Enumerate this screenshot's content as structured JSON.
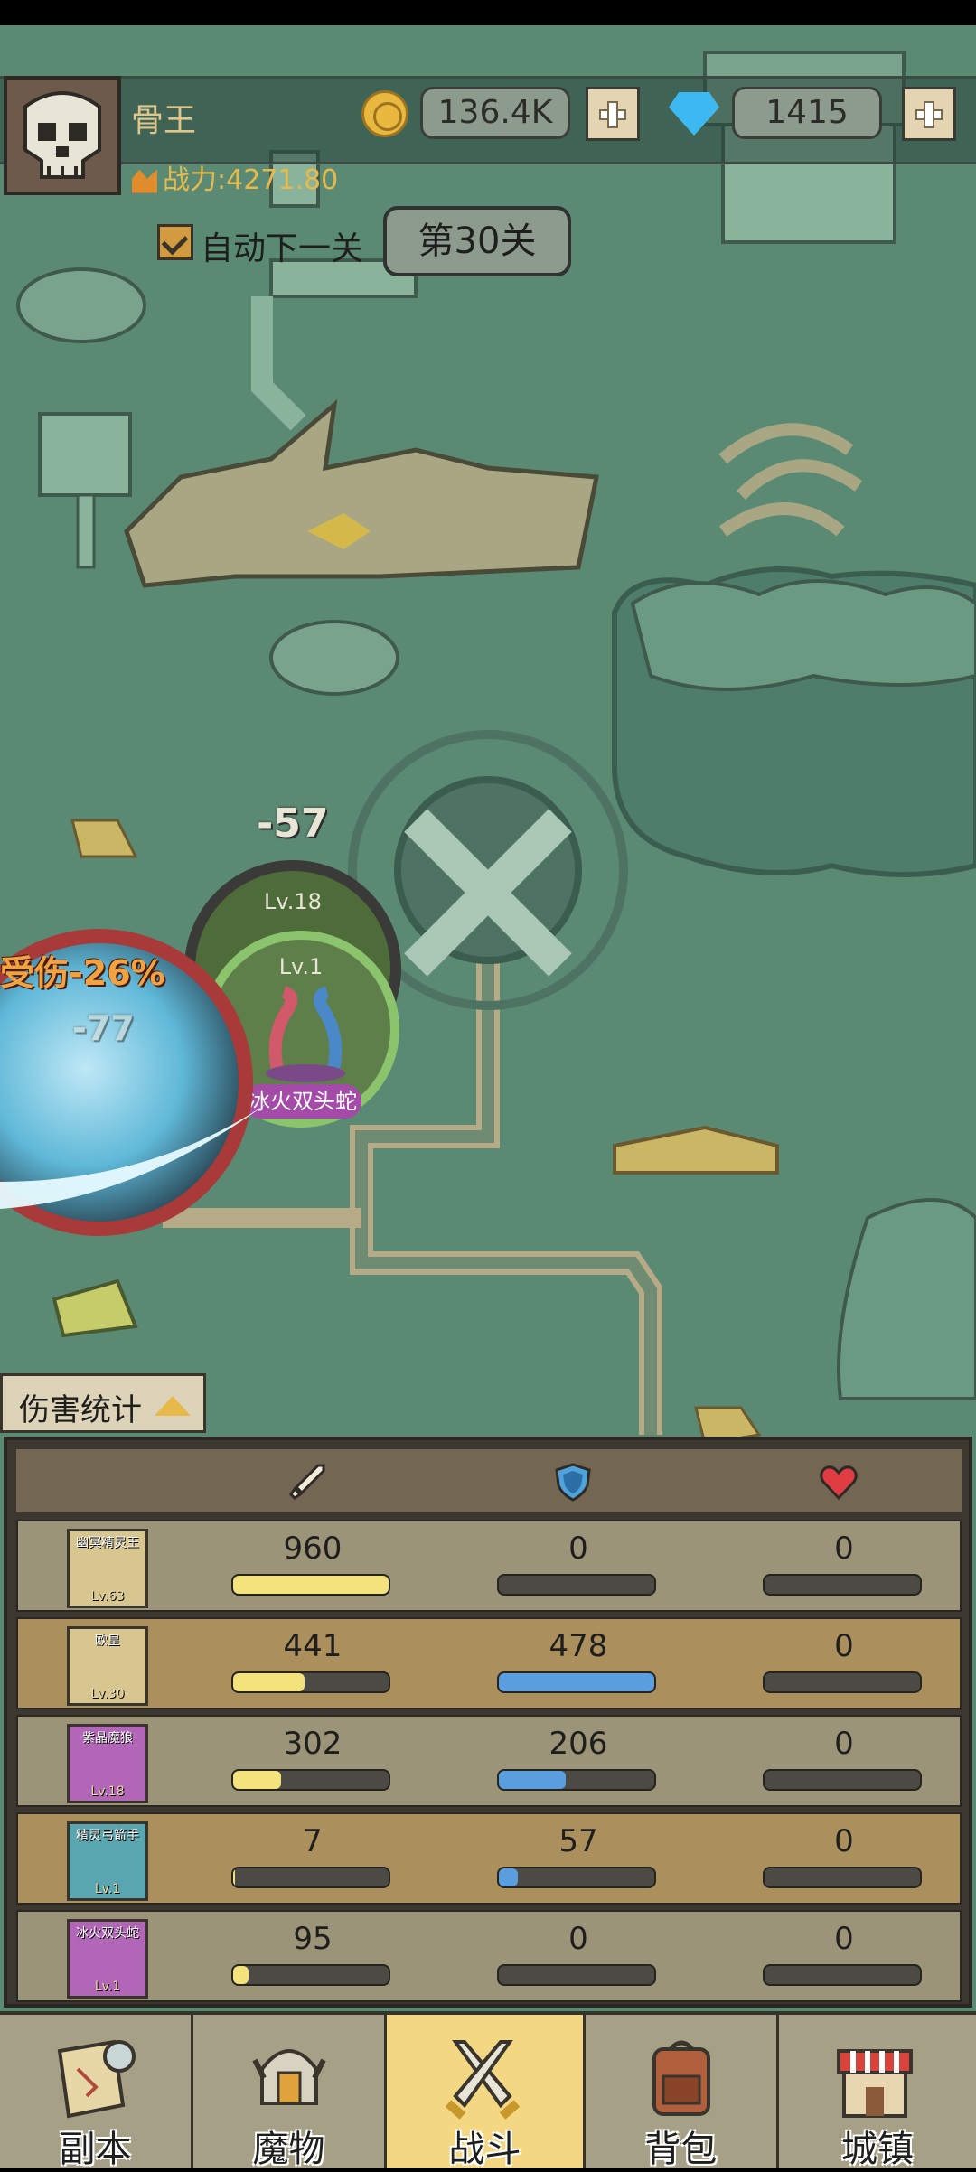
{
  "player": {
    "name": "骨王",
    "power": "战力:4271.80"
  },
  "currency": {
    "coins": "136.4K",
    "gems": "1415"
  },
  "stage": {
    "auto_next_label": "自动下一关",
    "auto_next_checked": true,
    "level_label": "第30关"
  },
  "battle": {
    "damage_floats": [
      "-57",
      "-77"
    ],
    "enemy_status": "受伤-26%",
    "units": [
      {
        "level": "Lv.18"
      },
      {
        "level": "Lv.1",
        "name": "冰火双头蛇"
      }
    ]
  },
  "damage_stats": {
    "toggle_label": "伤害统计",
    "columns": [
      {
        "icon": "sword-icon"
      },
      {
        "icon": "shield-icon"
      },
      {
        "icon": "heart-icon"
      }
    ],
    "rows": [
      {
        "name": "幽冥精灵王",
        "level": "Lv.63",
        "portrait_color": "#d8c690",
        "atk": "960",
        "def": "0",
        "heal": "0",
        "atk_frac": 1.0,
        "def_frac": 0,
        "heal_frac": 0
      },
      {
        "name": "欧皇",
        "level": "Lv.30",
        "portrait_color": "#d8c690",
        "atk": "441",
        "def": "478",
        "heal": "0",
        "atk_frac": 0.46,
        "def_frac": 1.0,
        "heal_frac": 0
      },
      {
        "name": "紫晶魔狼",
        "level": "Lv.18",
        "portrait_color": "#b266b8",
        "atk": "302",
        "def": "206",
        "heal": "0",
        "atk_frac": 0.31,
        "def_frac": 0.43,
        "heal_frac": 0
      },
      {
        "name": "精灵弓箭手",
        "level": "Lv.1",
        "portrait_color": "#5aa6b0",
        "atk": "7",
        "def": "57",
        "heal": "0",
        "atk_frac": 0.01,
        "def_frac": 0.12,
        "heal_frac": 0
      },
      {
        "name": "冰火双头蛇",
        "level": "Lv.1",
        "portrait_color": "#b266b8",
        "atk": "95",
        "def": "0",
        "heal": "0",
        "atk_frac": 0.1,
        "def_frac": 0,
        "heal_frac": 0
      }
    ]
  },
  "nav": {
    "active": 2,
    "items": [
      {
        "label": "副本",
        "icon": "map-scroll-icon"
      },
      {
        "label": "魔物",
        "icon": "helmet-icon"
      },
      {
        "label": "战斗",
        "icon": "crossed-swords-icon"
      },
      {
        "label": "背包",
        "icon": "backpack-icon"
      },
      {
        "label": "城镇",
        "icon": "shop-icon"
      }
    ]
  }
}
